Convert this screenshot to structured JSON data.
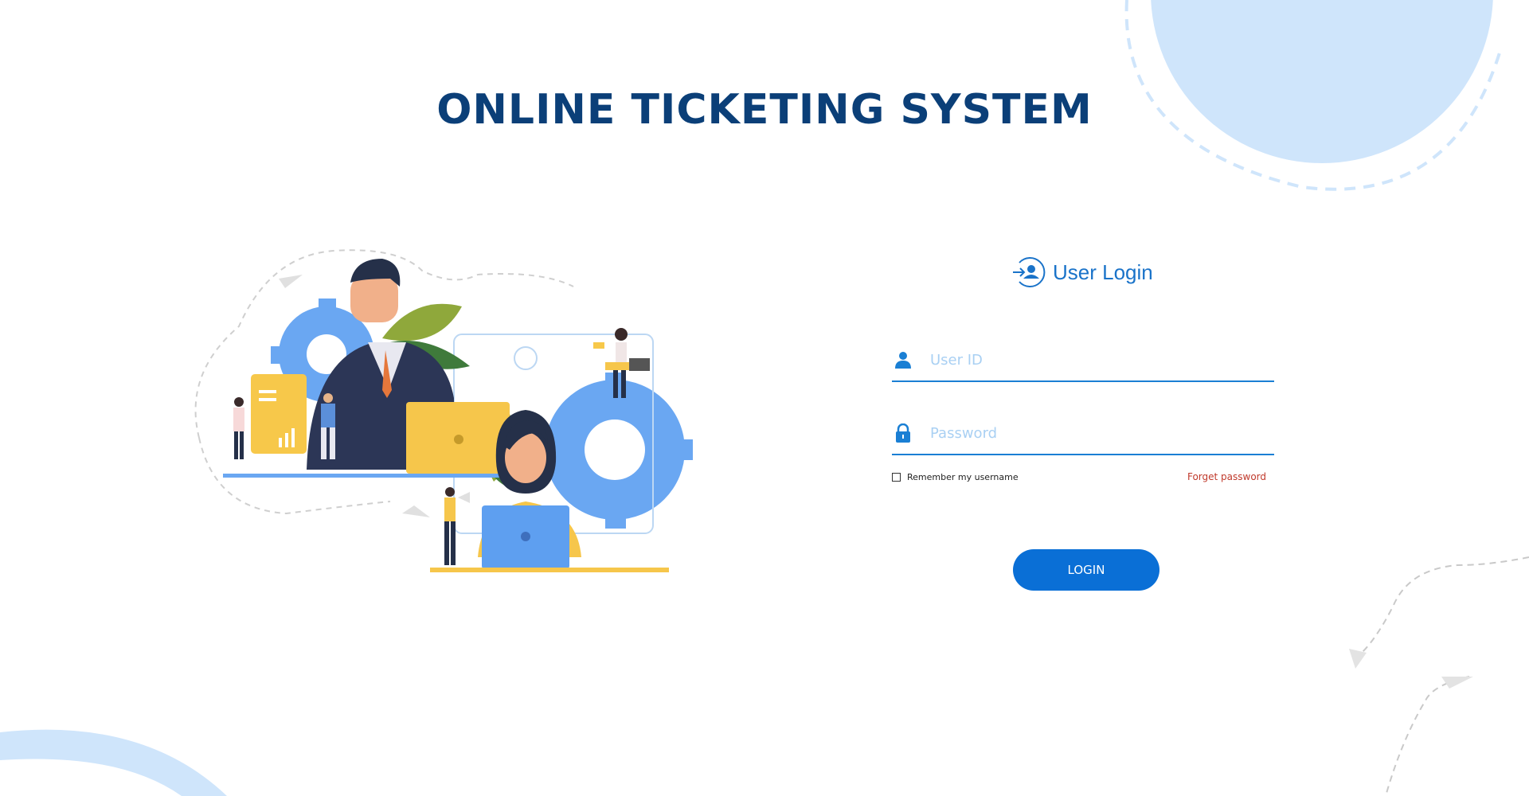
{
  "app": {
    "title": "ONLINE TICKETING SYSTEM"
  },
  "login": {
    "heading": "User Login",
    "user_id_placeholder": "User ID",
    "password_placeholder": "Password",
    "remember_label": "Remember my username",
    "forgot_label": "Forget password",
    "button_label": "LOGIN"
  },
  "icons": {
    "heading": "user-login-icon",
    "user_field": "user-icon",
    "password_field": "lock-icon"
  },
  "colors": {
    "title": "#0b3f78",
    "accent": "#1a7fd4",
    "button": "#0a6fd6",
    "placeholder": "#a9d0f3",
    "forgot": "#c0392b",
    "deco_circle": "#cfe5fb"
  }
}
